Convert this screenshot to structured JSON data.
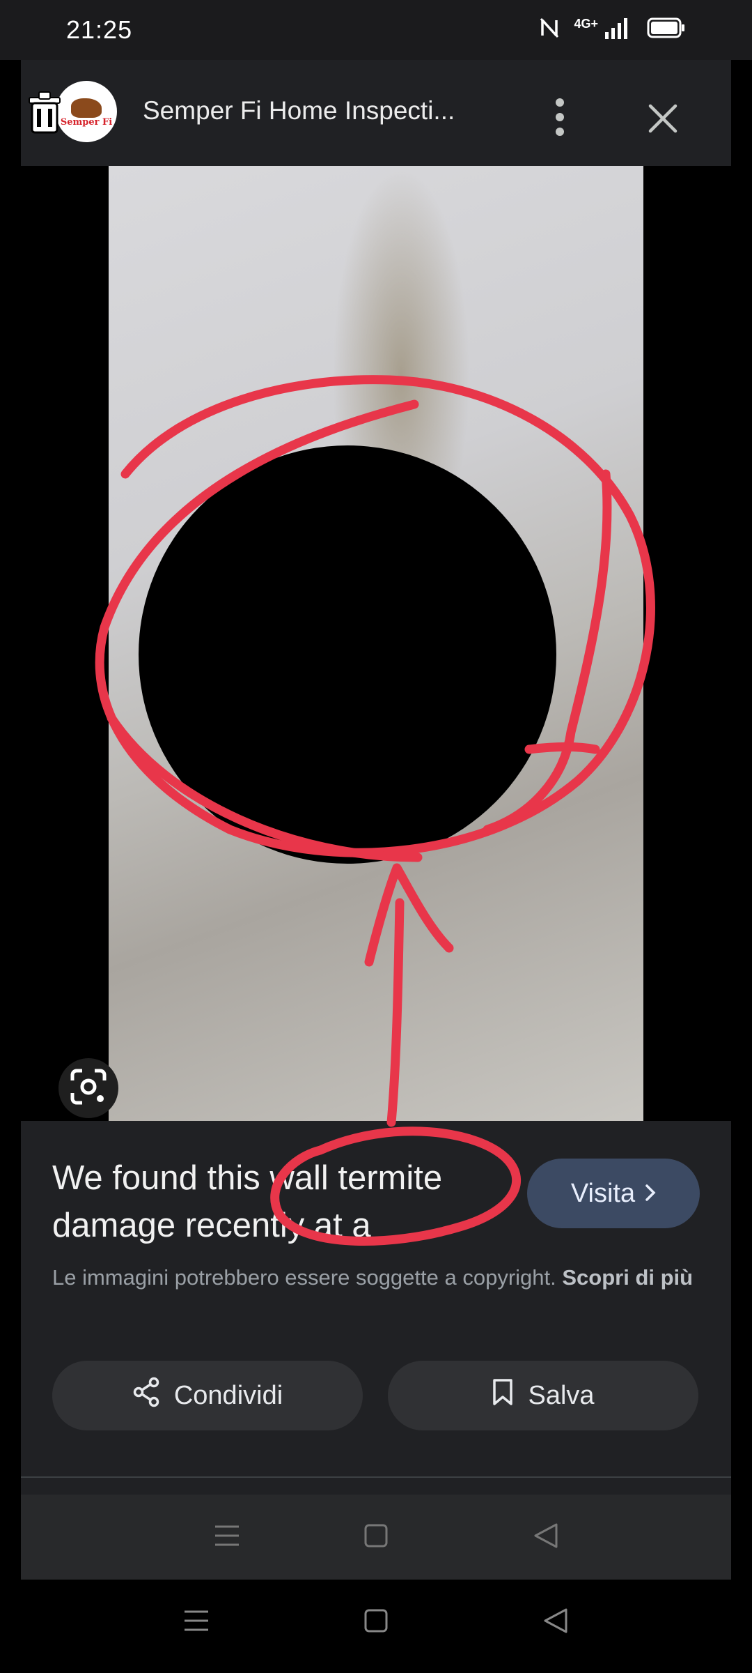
{
  "status_bar": {
    "time": "21:25",
    "network_label": "4G+",
    "icons": [
      "nfc-icon",
      "signal-icon",
      "battery-icon"
    ]
  },
  "header": {
    "logo_text": "Semper Fi",
    "title": "Semper Fi Home Inspecti...",
    "icons": [
      "trash-icon",
      "more-vert-icon",
      "close-icon"
    ]
  },
  "image_viewer": {
    "icons": [
      "lens-search-icon"
    ]
  },
  "info": {
    "headline": "We found this wall termite damage recently at a",
    "visit_label": "Visita",
    "copyright_text": "Le immagini potrebbero essere soggette a copyright.",
    "copyright_link": "Scopri di più",
    "share_label": "Condividi",
    "save_label": "Salva"
  },
  "navigation": {
    "buttons": [
      "menu-icon",
      "home-icon",
      "back-icon"
    ]
  },
  "colors": {
    "panel_bg": "#202124",
    "visit_button": "#3c4a63",
    "annotation_red": "#e8364a"
  }
}
